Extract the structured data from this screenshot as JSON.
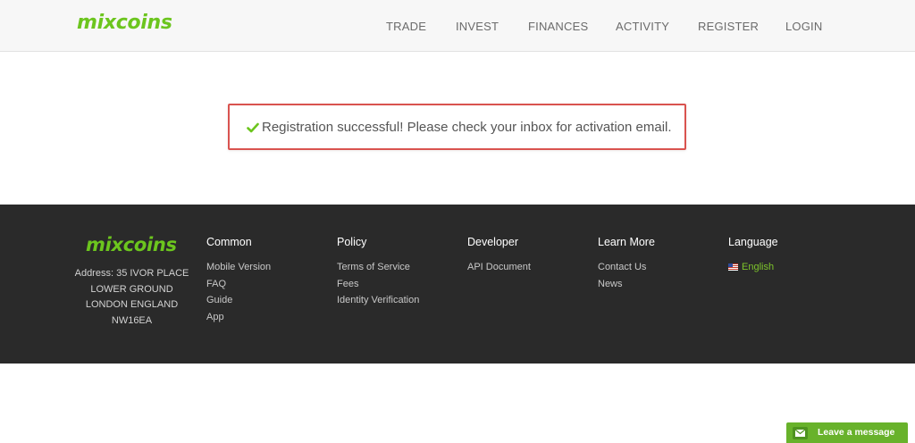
{
  "header": {
    "logo": "mixcoins",
    "nav": [
      "TRADE",
      "INVEST",
      "FINANCES",
      "ACTIVITY",
      "REGISTER",
      "LOGIN"
    ]
  },
  "message": {
    "icon": "check-icon",
    "text": "Registration successful! Please check your inbox for activation email."
  },
  "footer": {
    "logo": "mixcoins",
    "address": [
      "Address: 35 IVOR PLACE",
      "LOWER GROUND",
      "LONDON ENGLAND",
      "NW16EA"
    ],
    "columns": [
      {
        "title": "Common",
        "links": [
          "Mobile Version",
          "FAQ",
          "Guide",
          "App"
        ]
      },
      {
        "title": "Policy",
        "links": [
          "Terms of Service",
          "Fees",
          "Identity Verification"
        ]
      },
      {
        "title": "Developer",
        "links": [
          "API Document"
        ]
      },
      {
        "title": "Learn More",
        "links": [
          "Contact Us",
          "News"
        ]
      },
      {
        "title": "Language",
        "links": [
          "English"
        ]
      }
    ]
  },
  "chat": {
    "label": "Leave a message",
    "icon": "envelope-icon"
  },
  "colors": {
    "brand_green": "#6cc51e",
    "alert_border": "#d9534f",
    "footer_bg": "#2a2a2a",
    "chat_bg": "#68b22b"
  }
}
